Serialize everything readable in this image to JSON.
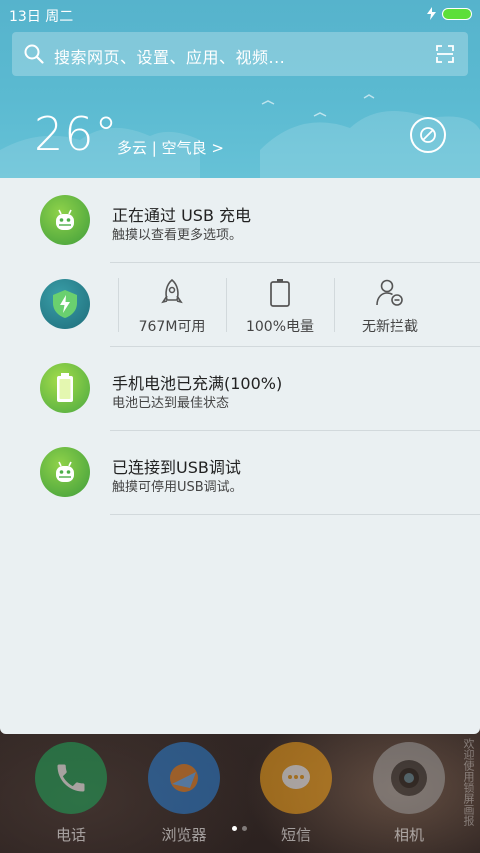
{
  "status_bar": {
    "time": "13日 周二"
  },
  "search": {
    "placeholder": "搜索网页、设置、应用、视频..."
  },
  "weather": {
    "temperature": "26°",
    "description": "多云 | 空气良 >"
  },
  "notifications": [
    {
      "title": "正在通过 USB 充电",
      "subtitle": "触摸以查看更多选项。",
      "icon": "android-icon"
    },
    {
      "title": "手机电池已充满(100%)",
      "subtitle": "电池已达到最佳状态",
      "icon": "battery-full-icon"
    },
    {
      "title": "已连接到USB调试",
      "subtitle": "触摸可停用USB调试。",
      "icon": "android-icon"
    }
  ],
  "security": {
    "icon": "shield-lightning-icon",
    "stats": [
      {
        "label": "767M可用",
        "icon": "rocket-icon"
      },
      {
        "label": "100%电量",
        "icon": "battery-icon"
      },
      {
        "label": "无新拦截",
        "icon": "user-block-icon"
      }
    ]
  },
  "dock": [
    {
      "label": "电话",
      "icon": "phone-icon",
      "color": "#1fa65a"
    },
    {
      "label": "浏览器",
      "icon": "browser-icon",
      "color": "#2a7fd4"
    },
    {
      "label": "短信",
      "icon": "message-icon",
      "color": "#f2a11a"
    },
    {
      "label": "相机",
      "icon": "camera-icon",
      "color": "#9a9a9a"
    }
  ],
  "side_text": "欢迎使用锁屏画报",
  "colors": {
    "header": "#5bbad1",
    "panel": "#eaf0f2",
    "accent_green": "#4cae4a",
    "battery": "#5ddf3a"
  }
}
